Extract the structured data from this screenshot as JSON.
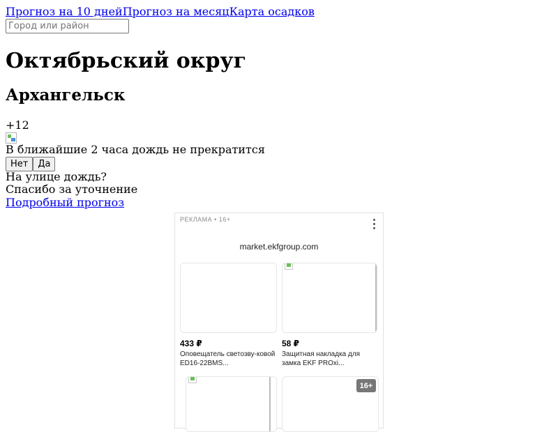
{
  "nav": {
    "links": [
      "Прогноз на 10 дней",
      "Прогноз на месяц",
      "Карта осадков"
    ]
  },
  "search": {
    "placeholder": "Город или район",
    "value": ""
  },
  "district": "Октябрьский округ",
  "city": "Архангельск",
  "temperature": "+12",
  "forecast_text": "В ближайшие 2 часа дождь не прекратится",
  "feedback": {
    "no_label": "Нет",
    "yes_label": "Да",
    "question": "На улице дождь?",
    "thanks": "Спасибо за уточнение"
  },
  "detailed_link": "Подробный прогноз",
  "ad": {
    "label": "РЕКЛАМА • 16+",
    "domain": "market.ekfgroup.com",
    "products": [
      {
        "price": "433 ₽",
        "title": "Оповещатель светозву-ковой ED16-22BMS..."
      },
      {
        "price": "58 ₽",
        "title": "Защитная накладка для замка EKF PROxi..."
      }
    ],
    "age_badge": "16+"
  }
}
